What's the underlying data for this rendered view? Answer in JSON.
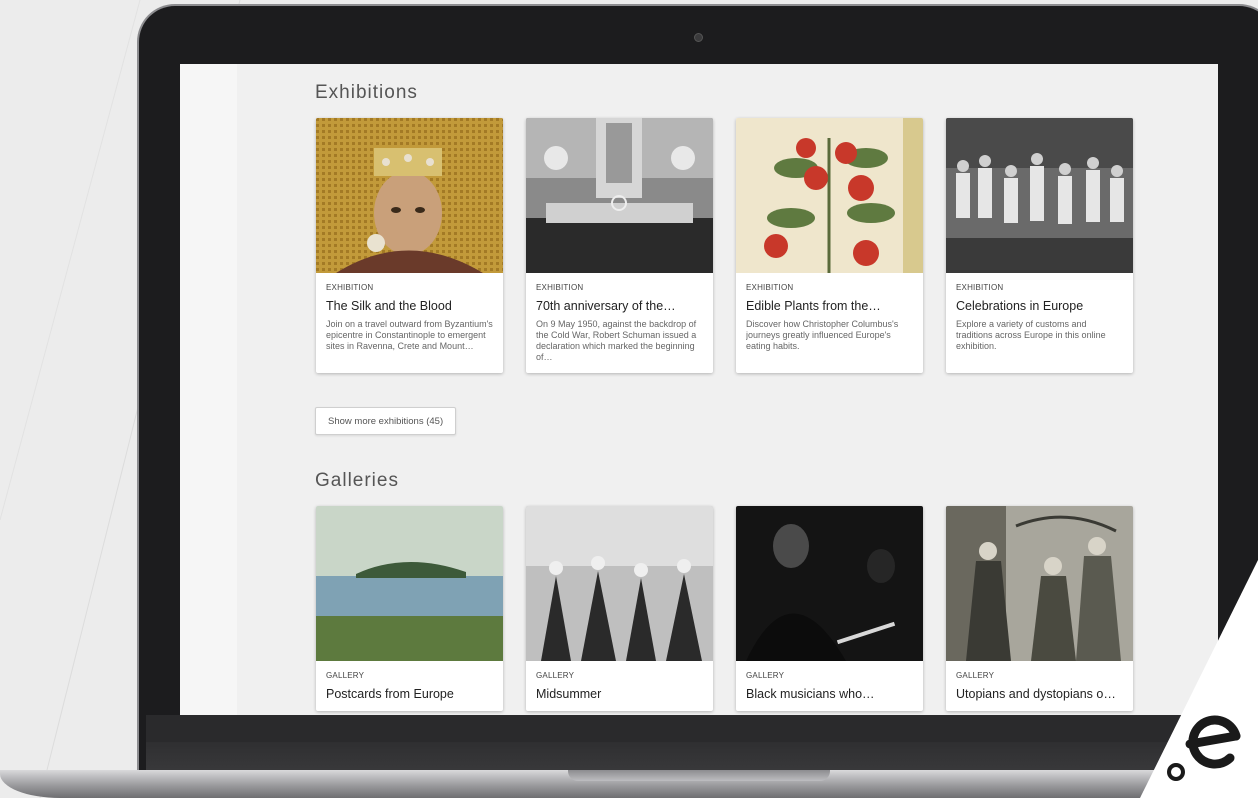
{
  "exhibitions": {
    "heading": "Exhibitions",
    "show_more_label": "Show more exhibitions (45)",
    "items": [
      {
        "tag": "EXHIBITION",
        "title": "The Silk and the Blood",
        "description": "Join on a travel outward from Byzantium's epicentre in Constantinople to emergent sites in Ravenna, Crete and Mount…"
      },
      {
        "tag": "EXHIBITION",
        "title": "70th anniversary of the…",
        "description": "On 9 May 1950, against the backdrop of the Cold War, Robert Schuman issued a declaration which marked the beginning of…"
      },
      {
        "tag": "EXHIBITION",
        "title": "Edible Plants from the…",
        "description": "Discover how Christopher Columbus's journeys greatly influenced Europe's eating habits."
      },
      {
        "tag": "EXHIBITION",
        "title": "Celebrations in Europe",
        "description": "Explore a variety of customs and traditions across Europe in this online exhibition."
      }
    ]
  },
  "galleries": {
    "heading": "Galleries",
    "items": [
      {
        "tag": "GALLERY",
        "title": "Postcards from Europe"
      },
      {
        "tag": "GALLERY",
        "title": "Midsummer"
      },
      {
        "tag": "GALLERY",
        "title": "Black musicians who…"
      },
      {
        "tag": "GALLERY",
        "title": "Utopians and dystopians o…"
      }
    ]
  },
  "colors": {
    "page_background": "#f0f0f0",
    "card_background": "#ffffff",
    "heading_text": "#555555",
    "logo_mark": "#1a1a1a"
  }
}
